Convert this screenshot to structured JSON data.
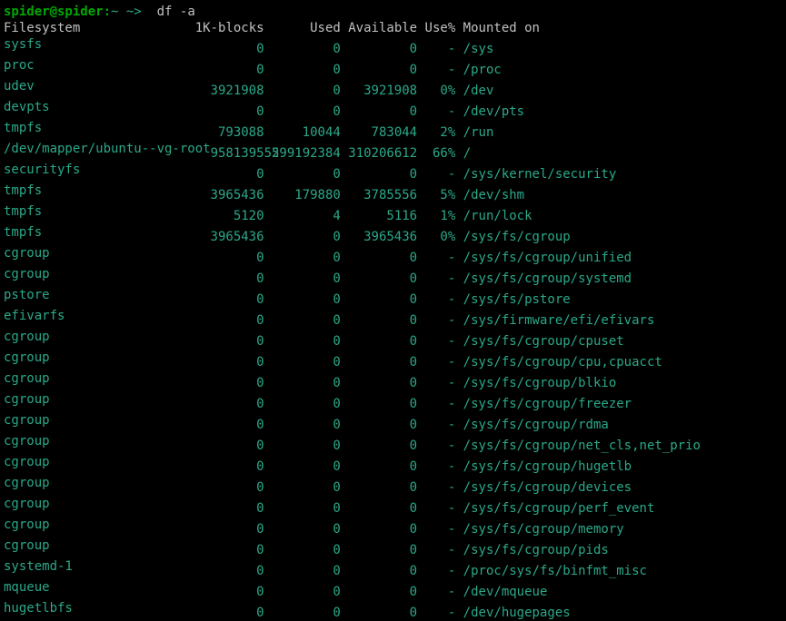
{
  "prompt": {
    "user": "spider@spider",
    "sep": ":",
    "path": "~",
    "arrow": " ~> ",
    "command": " df -a"
  },
  "header": {
    "fs": "Filesystem",
    "blocks": "1K-blocks",
    "used": "Used",
    "avail": "Available",
    "usep": "Use%",
    "mnt": "Mounted on"
  },
  "rows": [
    {
      "fs": "sysfs",
      "blocks": "0",
      "used": "0",
      "avail": "0",
      "usep": "-",
      "mnt": "/sys"
    },
    {
      "fs": "proc",
      "blocks": "0",
      "used": "0",
      "avail": "0",
      "usep": "-",
      "mnt": "/proc"
    },
    {
      "fs": "udev",
      "blocks": "3921908",
      "used": "0",
      "avail": "3921908",
      "usep": "0%",
      "mnt": "/dev"
    },
    {
      "fs": "devpts",
      "blocks": "0",
      "used": "0",
      "avail": "0",
      "usep": "-",
      "mnt": "/dev/pts"
    },
    {
      "fs": "tmpfs",
      "blocks": "793088",
      "used": "10044",
      "avail": "783044",
      "usep": "2%",
      "mnt": "/run"
    },
    {
      "fs": "/dev/mapper/ubuntu--vg-root",
      "blocks": "958139552",
      "used": "599192384",
      "avail": "310206612",
      "usep": "66%",
      "mnt": "/"
    },
    {
      "fs": "securityfs",
      "blocks": "0",
      "used": "0",
      "avail": "0",
      "usep": "-",
      "mnt": "/sys/kernel/security"
    },
    {
      "fs": "tmpfs",
      "blocks": "3965436",
      "used": "179880",
      "avail": "3785556",
      "usep": "5%",
      "mnt": "/dev/shm"
    },
    {
      "fs": "tmpfs",
      "blocks": "5120",
      "used": "4",
      "avail": "5116",
      "usep": "1%",
      "mnt": "/run/lock"
    },
    {
      "fs": "tmpfs",
      "blocks": "3965436",
      "used": "0",
      "avail": "3965436",
      "usep": "0%",
      "mnt": "/sys/fs/cgroup"
    },
    {
      "fs": "cgroup",
      "blocks": "0",
      "used": "0",
      "avail": "0",
      "usep": "-",
      "mnt": "/sys/fs/cgroup/unified"
    },
    {
      "fs": "cgroup",
      "blocks": "0",
      "used": "0",
      "avail": "0",
      "usep": "-",
      "mnt": "/sys/fs/cgroup/systemd"
    },
    {
      "fs": "pstore",
      "blocks": "0",
      "used": "0",
      "avail": "0",
      "usep": "-",
      "mnt": "/sys/fs/pstore"
    },
    {
      "fs": "efivarfs",
      "blocks": "0",
      "used": "0",
      "avail": "0",
      "usep": "-",
      "mnt": "/sys/firmware/efi/efivars"
    },
    {
      "fs": "cgroup",
      "blocks": "0",
      "used": "0",
      "avail": "0",
      "usep": "-",
      "mnt": "/sys/fs/cgroup/cpuset"
    },
    {
      "fs": "cgroup",
      "blocks": "0",
      "used": "0",
      "avail": "0",
      "usep": "-",
      "mnt": "/sys/fs/cgroup/cpu,cpuacct"
    },
    {
      "fs": "cgroup",
      "blocks": "0",
      "used": "0",
      "avail": "0",
      "usep": "-",
      "mnt": "/sys/fs/cgroup/blkio"
    },
    {
      "fs": "cgroup",
      "blocks": "0",
      "used": "0",
      "avail": "0",
      "usep": "-",
      "mnt": "/sys/fs/cgroup/freezer"
    },
    {
      "fs": "cgroup",
      "blocks": "0",
      "used": "0",
      "avail": "0",
      "usep": "-",
      "mnt": "/sys/fs/cgroup/rdma"
    },
    {
      "fs": "cgroup",
      "blocks": "0",
      "used": "0",
      "avail": "0",
      "usep": "-",
      "mnt": "/sys/fs/cgroup/net_cls,net_prio"
    },
    {
      "fs": "cgroup",
      "blocks": "0",
      "used": "0",
      "avail": "0",
      "usep": "-",
      "mnt": "/sys/fs/cgroup/hugetlb"
    },
    {
      "fs": "cgroup",
      "blocks": "0",
      "used": "0",
      "avail": "0",
      "usep": "-",
      "mnt": "/sys/fs/cgroup/devices"
    },
    {
      "fs": "cgroup",
      "blocks": "0",
      "used": "0",
      "avail": "0",
      "usep": "-",
      "mnt": "/sys/fs/cgroup/perf_event"
    },
    {
      "fs": "cgroup",
      "blocks": "0",
      "used": "0",
      "avail": "0",
      "usep": "-",
      "mnt": "/sys/fs/cgroup/memory"
    },
    {
      "fs": "cgroup",
      "blocks": "0",
      "used": "0",
      "avail": "0",
      "usep": "-",
      "mnt": "/sys/fs/cgroup/pids"
    },
    {
      "fs": "systemd-1",
      "blocks": "0",
      "used": "0",
      "avail": "0",
      "usep": "-",
      "mnt": "/proc/sys/fs/binfmt_misc"
    },
    {
      "fs": "mqueue",
      "blocks": "0",
      "used": "0",
      "avail": "0",
      "usep": "-",
      "mnt": "/dev/mqueue"
    },
    {
      "fs": "hugetlbfs",
      "blocks": "0",
      "used": "0",
      "avail": "0",
      "usep": "-",
      "mnt": "/dev/hugepages"
    }
  ]
}
